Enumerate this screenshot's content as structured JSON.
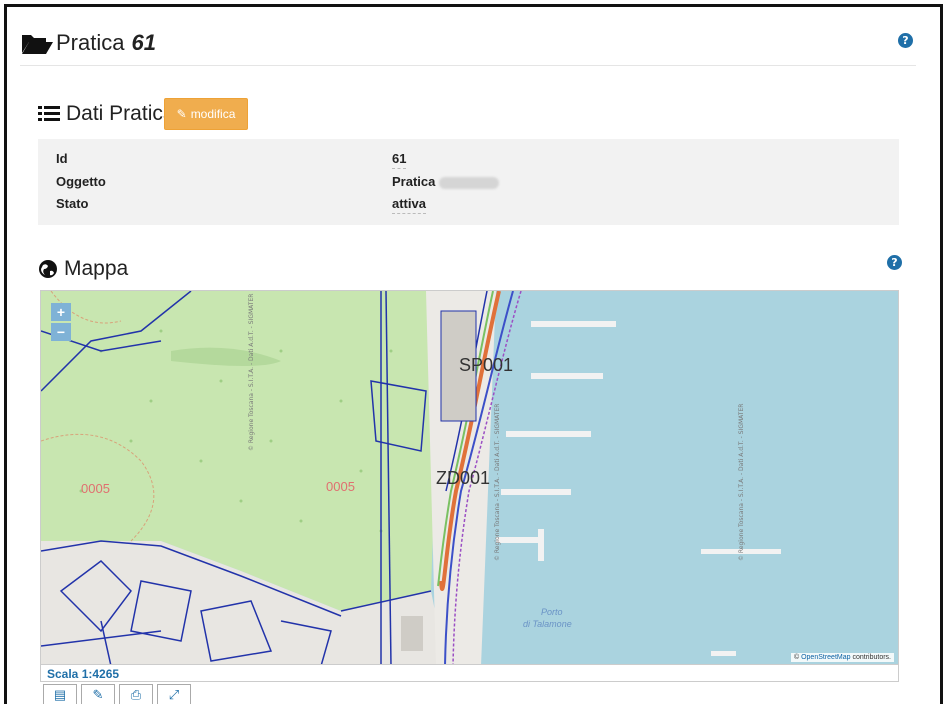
{
  "header": {
    "title": "Pratica",
    "number": "61",
    "help_icon": "question-circle-icon"
  },
  "dati_pratica": {
    "title": "Dati Pratica",
    "edit_button": "modifica",
    "fields": [
      {
        "label": "Id",
        "value": "61"
      },
      {
        "label": "Oggetto",
        "value": "Pratica"
      },
      {
        "label": "Stato",
        "value": "attiva"
      }
    ]
  },
  "mappa": {
    "title": "Mappa",
    "zoom_in": "+",
    "zoom_out": "−",
    "labels": {
      "sp001": "SP001",
      "zd001": "ZD001",
      "parcel_a": "0005",
      "parcel_b": "0005",
      "porto": "Porto",
      "porto2": "di Talamone",
      "watermark": "© Regione Toscana - S.I.T.A. - Dati A.d.T. - SIGMATER"
    },
    "attribution_prefix": "©",
    "attribution_link": "OpenStreetMap",
    "attribution_suffix": "contributors.",
    "scale": "Scala 1:4265"
  },
  "toolbar": [
    "table-icon",
    "pencil-icon",
    "print-icon",
    "fullscreen-icon"
  ],
  "colors": {
    "accent": "#f0ad4e",
    "link": "#1f6fa8",
    "sea": "#aad3df",
    "park": "#c8e6b0"
  }
}
